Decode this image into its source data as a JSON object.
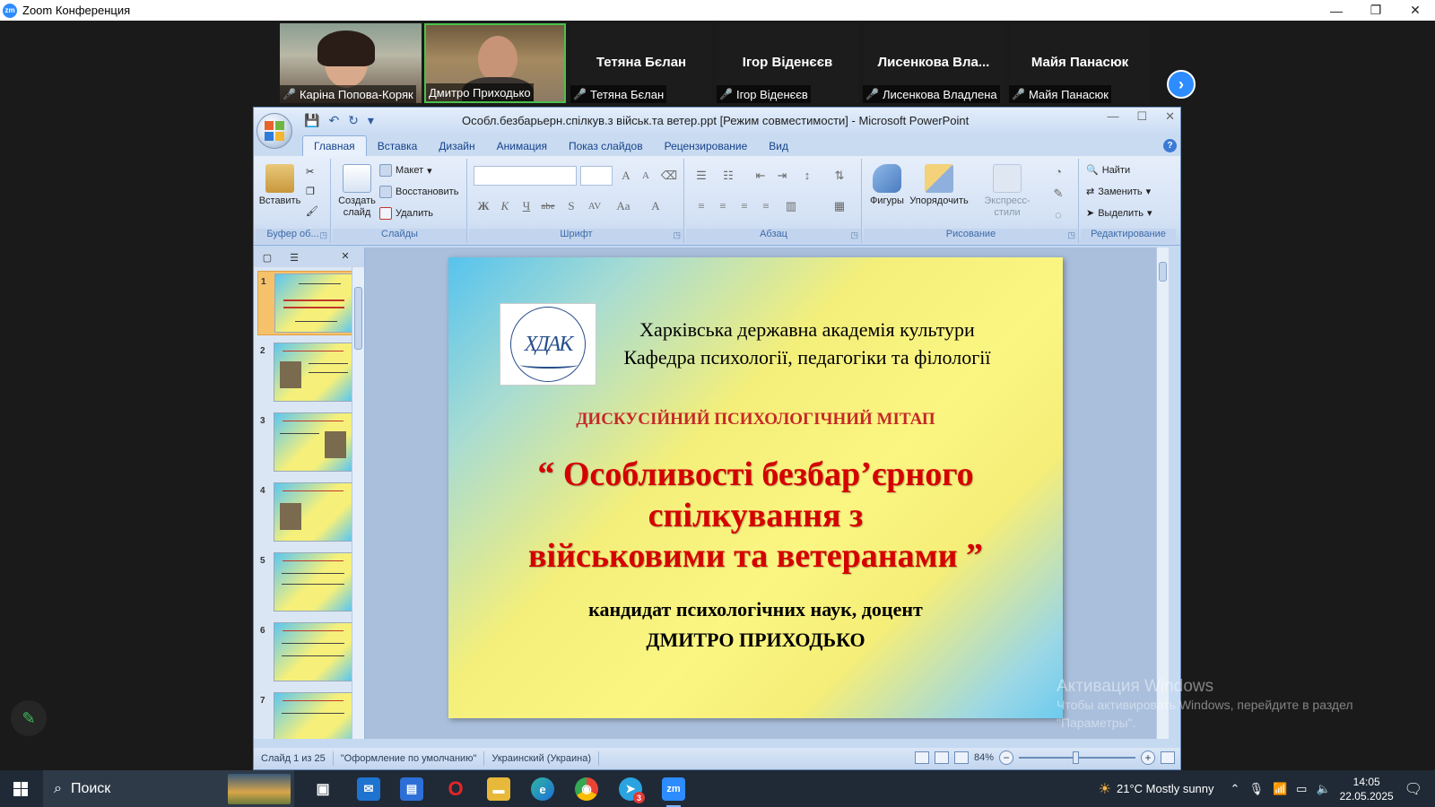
{
  "zoom": {
    "window_title": "Zoom Конференция",
    "logo_text": "zm",
    "participants": [
      {
        "caption": "Каріна Попова-Коряк",
        "video": true
      },
      {
        "caption": "Дмитро Приходько",
        "video": true,
        "active_speaker": true
      },
      {
        "caption": "Тетяна Бєлан",
        "big_name": "Тетяна Бєлан",
        "video": false
      },
      {
        "caption": "Ігор Віденєєв",
        "big_name": "Ігор Віденєєв",
        "video": false
      },
      {
        "caption": "Лисенкова Владлена",
        "big_name": "Лисенкова  Вла...",
        "video": false
      },
      {
        "caption": "Майя Панасюк",
        "big_name": "Майя Панасюк",
        "video": false
      }
    ],
    "next_arrow": "›",
    "pen_icon": "✎"
  },
  "ppt": {
    "doc_title": "Особл.безбарьерн.спілкув.з військ.та ветер.ppt [Режим совместимости] - Microsoft PowerPoint",
    "tabs": [
      "Главная",
      "Вставка",
      "Дизайн",
      "Анимация",
      "Показ слайдов",
      "Рецензирование",
      "Вид"
    ],
    "active_tab": "Главная",
    "groups": {
      "clipboard": {
        "name": "Буфер об...",
        "paste": "Вставить"
      },
      "slides": {
        "name": "Слайды",
        "new_slide": "Создать слайд",
        "layout": "Макет",
        "reset": "Восстановить",
        "delete": "Удалить"
      },
      "font": {
        "name": "Шрифт",
        "bold": "Ж",
        "italic": "К",
        "underline": "Ч",
        "strike": "abe",
        "shadow": "S",
        "spacing": "AV",
        "case": "Aa",
        "color": "A"
      },
      "paragraph": {
        "name": "Абзац"
      },
      "drawing": {
        "name": "Рисование",
        "shapes": "Фигуры",
        "arrange": "Упорядочить",
        "quick_styles": "Экспресс-стили"
      },
      "editing": {
        "name": "Редактирование",
        "find": "Найти",
        "replace": "Заменить",
        "select": "Выделить"
      }
    },
    "pane_tabs": [
      "▢",
      "☰"
    ],
    "thumbnails": [
      {
        "num": "1",
        "selected": true
      },
      {
        "num": "2",
        "selected": false
      },
      {
        "num": "3",
        "selected": false
      },
      {
        "num": "4",
        "selected": false
      },
      {
        "num": "5",
        "selected": false
      },
      {
        "num": "6",
        "selected": false
      },
      {
        "num": "7",
        "selected": false
      }
    ],
    "slide": {
      "logo_text": "ХДАК",
      "org_line1": "Харківська державна академія культури",
      "org_line2": "Кафедра психології, педагогіки та філології",
      "event": "ДИСКУСІЙНИЙ ПСИХОЛОГІЧНИЙ МІТАП",
      "title_line1": "“ Особливості  безбар’єрного",
      "title_line2": "спілкування  з",
      "title_line3": "військовими та ветеранами ”",
      "degree": "кандидат психологічних наук, доцент",
      "author": "ДМИТРО  ПРИХОДЬКО"
    },
    "status": {
      "slide_of": "Слайд 1 из 25",
      "theme": "\"Оформление по умолчанию\"",
      "language": "Украинский (Украина)",
      "zoom": "84%"
    }
  },
  "activation": {
    "line1": "Активация Windows",
    "line2": "Чтобы активировать Windows, перейдите в раздел",
    "line3": "\"Параметры\"."
  },
  "taskbar": {
    "search_label": "Поиск",
    "weather": "21°C  Mostly sunny",
    "time": "14:05",
    "date": "22.05.2025",
    "telegram_badge": "3"
  }
}
